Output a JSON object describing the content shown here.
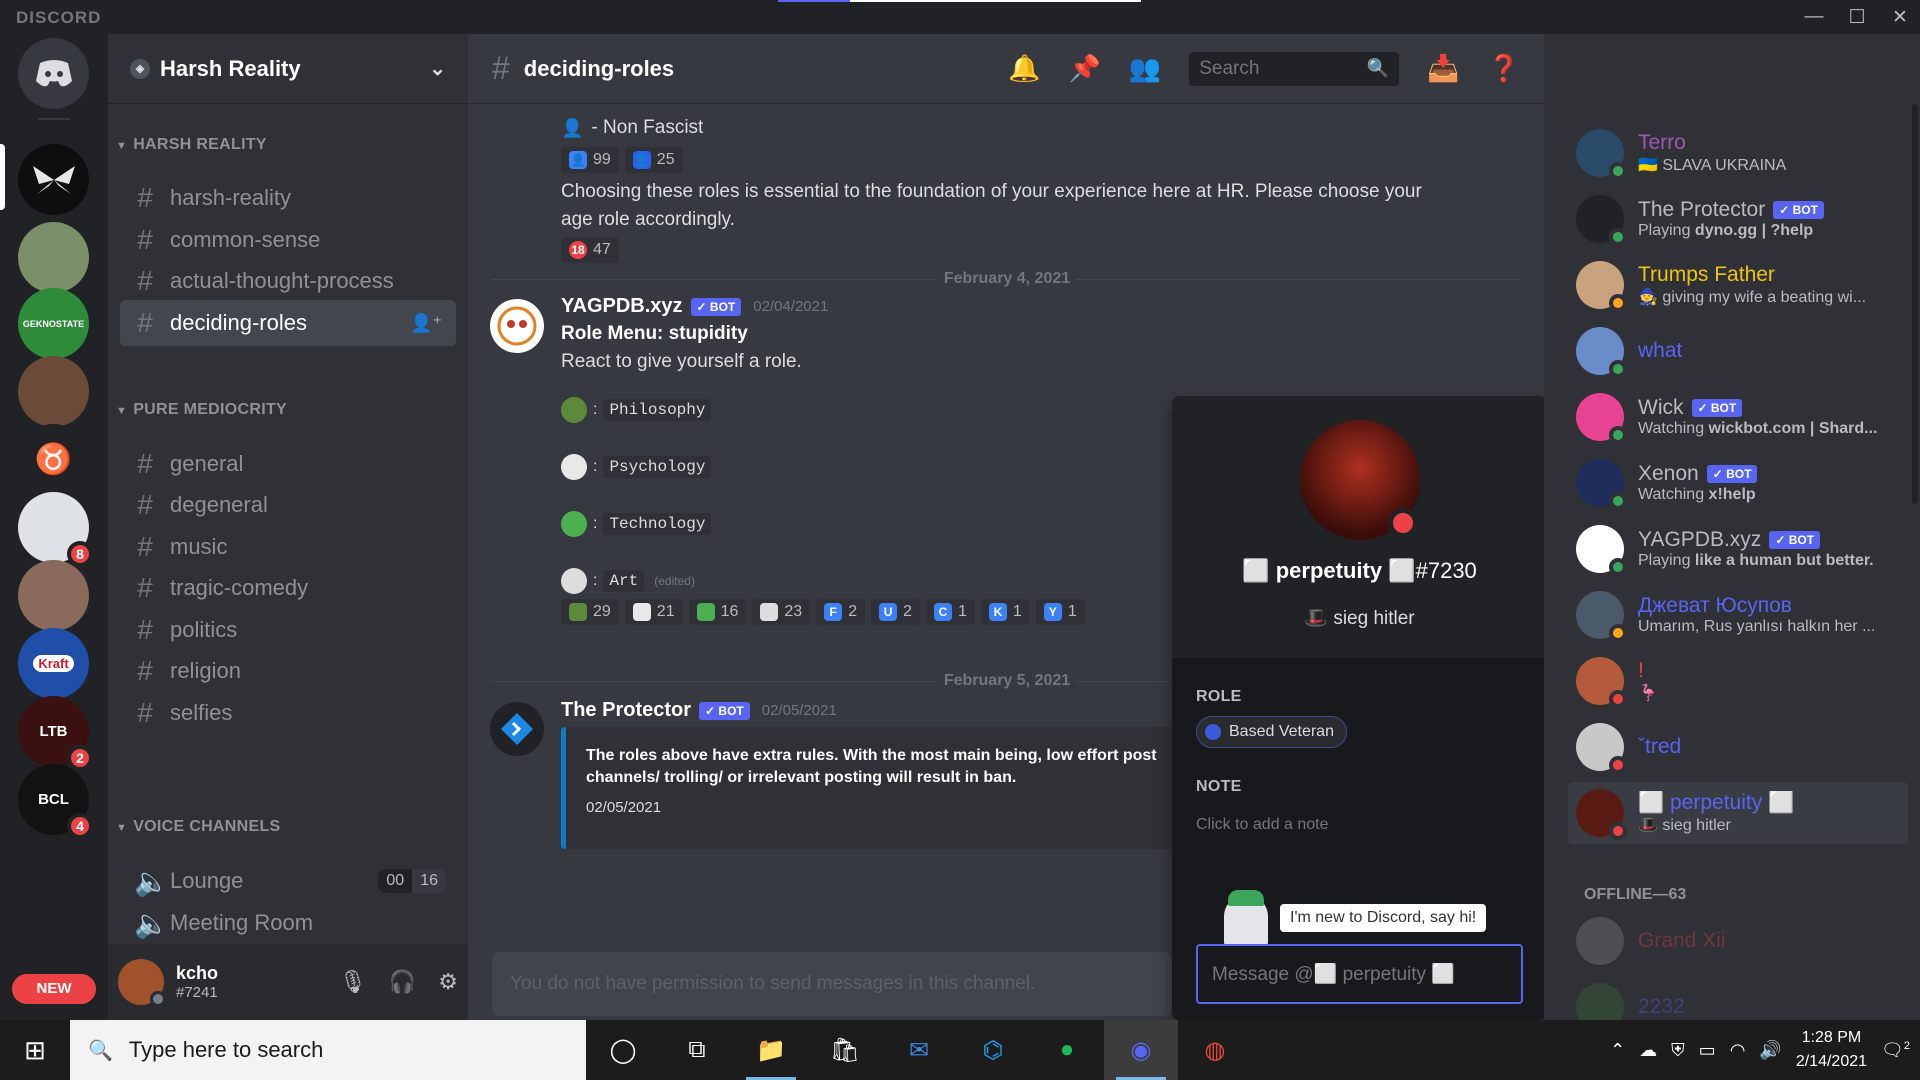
{
  "app": {
    "brand": "DISCORD",
    "window_controls": [
      "—",
      "☐",
      "✕"
    ],
    "new_badge": "NEW",
    "server_badges": [
      "8",
      "2",
      "4"
    ]
  },
  "guild": {
    "name": "Harsh Reality",
    "categories": [
      {
        "name": "HARSH REALITY",
        "channels": [
          "harsh-reality",
          "common-sense",
          "actual-thought-process",
          "deciding-roles"
        ]
      },
      {
        "name": "PURE MEDIOCRITY",
        "channels": [
          "general",
          "degeneral",
          "music",
          "tragic-comedy",
          "politics",
          "religion",
          "selfies"
        ]
      },
      {
        "name": "VOICE CHANNELS",
        "channels": [
          "Lounge",
          "Meeting Room"
        ]
      }
    ],
    "voice_counts": [
      "00",
      "16"
    ]
  },
  "user": {
    "name": "kcho",
    "tag": "#7241"
  },
  "channel": {
    "name": "deciding-roles",
    "search_placeholder": "Search"
  },
  "messages": {
    "top_line": "- Non Fascist",
    "reactions_1": [
      "99",
      "25"
    ],
    "paragraph": "Choosing these roles is essential to the foundation of your experience here at HR. Please choose your",
    "paragraph2": "age role accordingly.",
    "reaction_18": "47",
    "date1": "February 4, 2021",
    "yag": {
      "author": "YAGPDB.xyz",
      "bot": "✓ BOT",
      "timestamp": "02/04/2021",
      "title": "Role Menu: stupidity",
      "body": "React to give yourself a role.",
      "options": [
        "Philosophy",
        "Psychology",
        "Technology",
        "Art"
      ],
      "edited": "(edited)",
      "reactions": [
        {
          "emoji": "frog",
          "count": "29"
        },
        {
          "emoji": "ghost",
          "count": "21"
        },
        {
          "emoji": "pepe",
          "count": "16"
        },
        {
          "emoji": "think",
          "count": "23"
        },
        {
          "emoji": "F",
          "count": "2"
        },
        {
          "emoji": "U",
          "count": "2"
        },
        {
          "emoji": "C",
          "count": "1"
        },
        {
          "emoji": "K",
          "count": "1"
        },
        {
          "emoji": "Y",
          "count": "1"
        }
      ]
    },
    "date2": "February 5, 2021",
    "protector": {
      "author": "The Protector",
      "bot": "✓ BOT",
      "timestamp": "02/05/2021",
      "embed_text": "The roles above have extra rules. With the most main being, low effort post channels/ trolling/ or irrelevant posting will result in ban.",
      "embed_date": "02/05/2021"
    },
    "composer_placeholder": "You do not have permission to send messages in this channel."
  },
  "popout": {
    "name": "perpetuity",
    "prefix": "⬜",
    "suffix": "⬜#7230",
    "status": "sieg hitler",
    "role_header": "ROLE",
    "role": "Based Veteran",
    "note_header": "NOTE",
    "note_placeholder": "Click to add a note",
    "wumpus_bubble": "I'm new to Discord, say hi!",
    "message_placeholder": "Message @⬜ perpetuity ⬜"
  },
  "members": [
    {
      "name": "Terro",
      "sub": "SLAVA UKRAINA",
      "color": "#9b59b6",
      "status": "online"
    },
    {
      "name": "The Protector",
      "bot": "✓ BOT",
      "sub_prefix": "Playing ",
      "sub_bold": "dyno.gg | ?help",
      "color": "#b9bbbe",
      "status": "online"
    },
    {
      "name": "Trumps Father",
      "sub": "giving my wife a beating wi...",
      "color": "#f1c40f",
      "status": "idle"
    },
    {
      "name": "what",
      "sub": "",
      "color": "#5865f2",
      "status": "online"
    },
    {
      "name": "Wick",
      "bot": "✓ BOT",
      "sub_prefix": "Watching ",
      "sub_bold": "wickbot.com | Shard...",
      "color": "#b9bbbe",
      "status": "online"
    },
    {
      "name": "Xenon",
      "bot": "✓ BOT",
      "sub_prefix": "Watching ",
      "sub_bold": "x!help",
      "color": "#b9bbbe",
      "status": "online"
    },
    {
      "name": "YAGPDB.xyz",
      "bot": "✓ BOT",
      "sub_prefix": "Playing ",
      "sub_bold": "like a human but better.",
      "color": "#b9bbbe",
      "status": "online"
    },
    {
      "name": "Джеват Юсупов",
      "sub": "Umarım, Rus yanlısı halkın her ...",
      "color": "#5865f2",
      "status": "idle"
    },
    {
      "name": "!",
      "sub": "🦩",
      "color": "#ed4245",
      "status": "dnd"
    },
    {
      "name": "ˇtred",
      "sub": "",
      "color": "#5865f2",
      "status": "dnd"
    },
    {
      "name": "⬜ perpetuity ⬜",
      "sub": "sieg hitler",
      "color": "#5865f2",
      "status": "dnd"
    }
  ],
  "offline_header": "OFFLINE—63",
  "offline_members": [
    "Grand Xii",
    "2232"
  ],
  "taskbar": {
    "search_placeholder": "Type here to search",
    "time": "1:28 PM",
    "date": "2/14/2021",
    "notif_count": "2"
  }
}
